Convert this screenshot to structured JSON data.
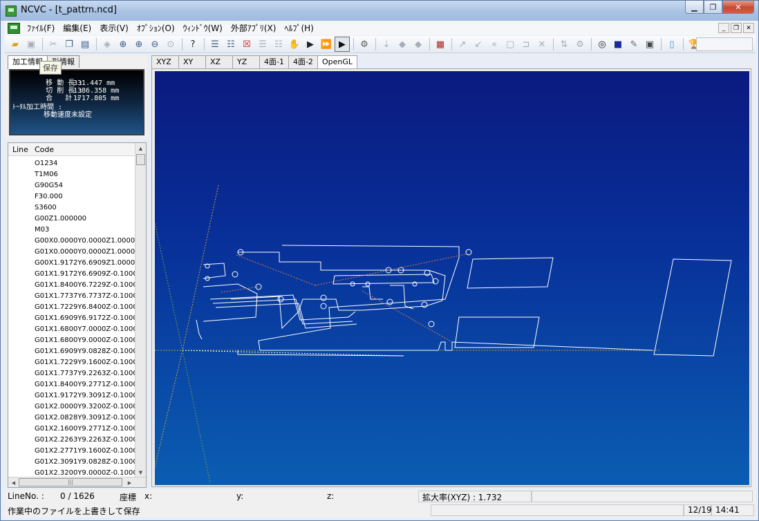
{
  "window": {
    "title": "NCVC - [t_pattrn.ncd]"
  },
  "menu": [
    {
      "label": "ﾌｧｲﾙ(F)"
    },
    {
      "label": "編集(E)"
    },
    {
      "label": "表示(V)"
    },
    {
      "label": "ｵﾌﾟｼｮﾝ(O)"
    },
    {
      "label": "ｳｨﾝﾄﾞｳ(W)"
    },
    {
      "label": "外部ｱﾌﾟﾘ(X)"
    },
    {
      "label": "ﾍﾙﾌﾟ(H)"
    }
  ],
  "tooltip": "保存",
  "info": {
    "tabs": [
      "加工情報",
      "形情報"
    ],
    "move_label": "移 動 長 :",
    "move_value": "331.447 mm",
    "cut_label": "切 削 長 :",
    "cut_value": "1386.358 mm",
    "total_label": "合   計 :",
    "total_value": "1717.805 mm",
    "time_label": "ﾄｰﾀﾙ加工時間 :",
    "time_value": "移動速度未設定"
  },
  "code": {
    "col_line": "Line",
    "col_code": "Code",
    "rows": [
      "O1234",
      "T1M06",
      "G90G54",
      "F30.000",
      "S3600",
      "G00Z1.000000",
      "M03",
      "G00X0.0000Y0.0000Z1.0000",
      "G01X0.0000Y0.0000Z1.0000",
      "G00X1.9172Y6.6909Z1.0000",
      "G01X1.9172Y6.6909Z-0.1000",
      "G01X1.8400Y6.7229Z-0.1000",
      "G01X1.7737Y6.7737Z-0.1000",
      "G01X1.7229Y6.8400Z-0.1000",
      "G01X1.6909Y6.9172Z-0.1000",
      "G01X1.6800Y7.0000Z-0.1000",
      "G01X1.6800Y9.0000Z-0.1000",
      "G01X1.6909Y9.0828Z-0.1000",
      "G01X1.7229Y9.1600Z-0.1000",
      "G01X1.7737Y9.2263Z-0.1000",
      "G01X1.8400Y9.2771Z-0.1000",
      "G01X1.9172Y9.3091Z-0.1000",
      "G01X2.0000Y9.3200Z-0.1000",
      "G01X2.0828Y9.3091Z-0.1000",
      "G01X2.1600Y9.2771Z-0.1000",
      "G01X2.2263Y9.2263Z-0.1000",
      "G01X2.2771Y9.1600Z-0.1000",
      "G01X2.3091Y9.0828Z-0.1000",
      "G01X2.3200Y9.0000Z-0.1000"
    ]
  },
  "view_tabs": [
    "XYZ",
    "XY",
    "XZ",
    "YZ",
    "4面-1",
    "4面-2",
    "OpenGL"
  ],
  "status": {
    "lineno_label": "LineNo. :",
    "lineno_value": "0 /   1626",
    "coord_label": "座標",
    "x_label": "x:",
    "y_label": "y:",
    "z_label": "z:",
    "zoom": "拡大率(XYZ) :  1.732",
    "message": "作業中のファイルを上書きして保存",
    "date": "12/19",
    "time": "14:41"
  },
  "colors": {
    "gl_top": "#0a1a80",
    "gl_bottom": "#0a5db2",
    "axis": "#c8a040"
  }
}
